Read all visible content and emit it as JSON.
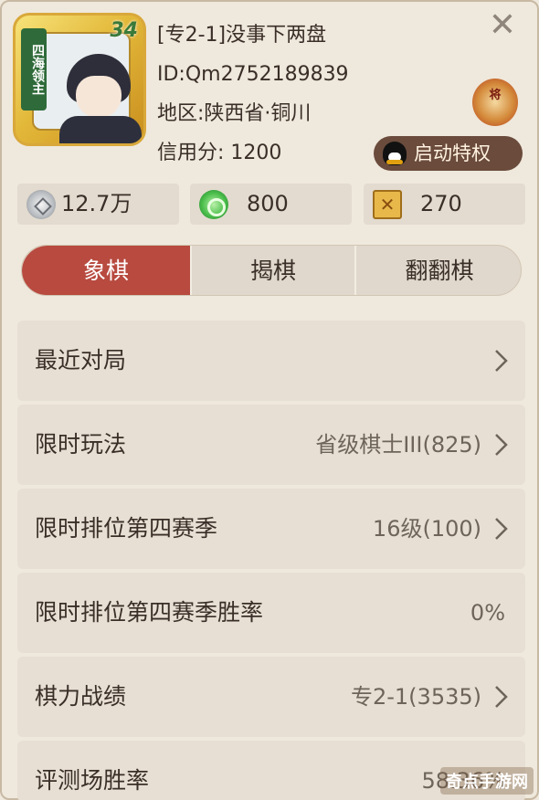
{
  "profile": {
    "avatar_level": "34",
    "avatar_badge": "四海领主",
    "nickname": "[专2-1]没事下两盘",
    "id": "ID:Qm2752189839",
    "region": "地区:陕西省·铜川",
    "credit": "信用分: 1200",
    "seal_text": "将",
    "privilege_label": "启动特权"
  },
  "currency": {
    "silver": "12.7万",
    "jade": "800",
    "ticket": "270"
  },
  "tabs": [
    {
      "label": "象棋",
      "active": true
    },
    {
      "label": "揭棋",
      "active": false
    },
    {
      "label": "翻翻棋",
      "active": false
    }
  ],
  "stats": [
    {
      "label": "最近对局",
      "value": ""
    },
    {
      "label": "限时玩法",
      "value": "省级棋士III(825)"
    },
    {
      "label": "限时排位第四赛季",
      "value": "16级(100)"
    },
    {
      "label": "限时排位第四赛季胜率",
      "value": "0%"
    },
    {
      "label": "棋力战绩",
      "value": "专2-1(3535)"
    },
    {
      "label": "评测场胜率",
      "value": "58.36%"
    }
  ],
  "watermark": "奇点手游网",
  "colors": {
    "accent": "#b84a3f",
    "background": "#efe8dc",
    "row": "#e7dfd3"
  }
}
